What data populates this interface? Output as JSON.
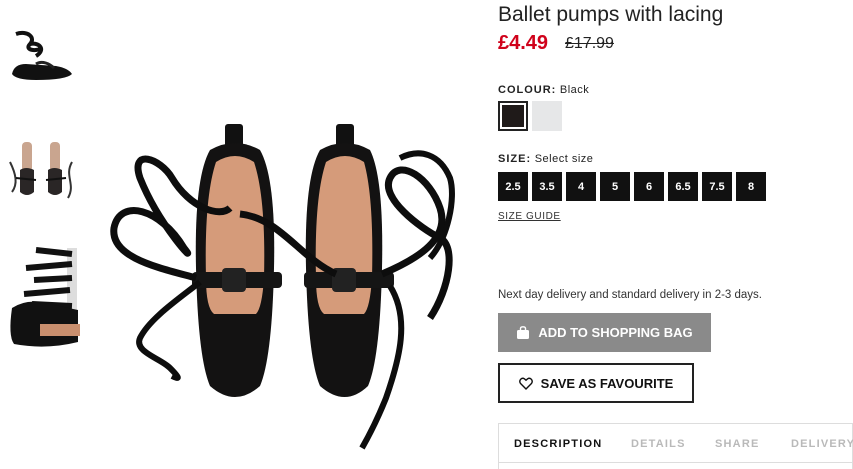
{
  "product": {
    "title": "Ballet pumps with lacing",
    "price": "£4.49",
    "old_price": "£17.99"
  },
  "colour": {
    "label": "COLOUR:",
    "selected": "Black",
    "swatches": [
      {
        "name": "Black",
        "hex": "#1f1a19"
      },
      {
        "name": "Light grey",
        "hex": "#e6e7e8"
      }
    ]
  },
  "size": {
    "label": "SIZE:",
    "prompt": "Select size",
    "options": [
      "2.5",
      "3.5",
      "4",
      "5",
      "6",
      "6.5",
      "7.5",
      "8"
    ],
    "guide_label": "SIZE GUIDE"
  },
  "delivery_text": "Next day delivery and standard delivery in 2-3 days.",
  "actions": {
    "add_to_bag": "ADD TO SHOPPING BAG",
    "save_favourite": "SAVE AS FAVOURITE"
  },
  "tabs": [
    {
      "label": "DESCRIPTION",
      "active": true
    },
    {
      "label": "DETAILS",
      "active": false
    },
    {
      "label": "SHARE",
      "active": false
    },
    {
      "label": "DELIVERY",
      "active": false
    }
  ],
  "colors": {
    "sale_red": "#d0021b",
    "bag_button": "#8a8a8a"
  },
  "icons": [
    "bag-icon",
    "heart-icon"
  ]
}
